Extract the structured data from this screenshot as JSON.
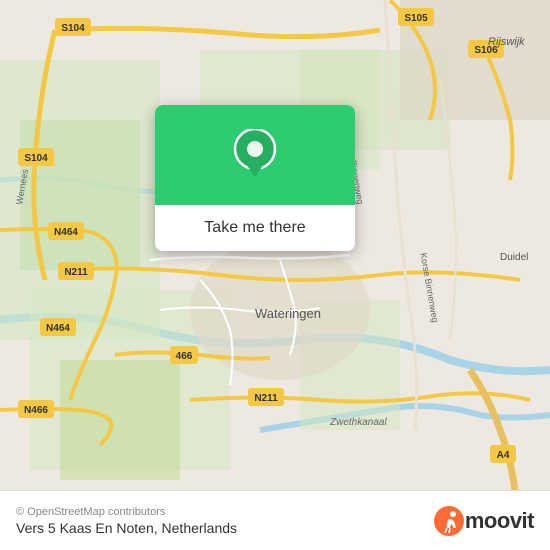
{
  "map": {
    "alt": "OpenStreetMap of Wateringen, Netherlands"
  },
  "popup": {
    "button_label": "Take me there"
  },
  "footer": {
    "copyright": "© OpenStreetMap contributors",
    "location_name": "Vers 5 Kaas En Noten, Netherlands"
  },
  "moovit": {
    "label": "moovit"
  },
  "road_labels": {
    "s104_top": "S104",
    "s104_left": "S104",
    "s105": "S105",
    "s106": "S106",
    "n211_left": "N211",
    "n211_bottom": "N211",
    "n464_top": "N464",
    "n464_bottom": "N464",
    "n466": "N466",
    "r466": "466",
    "a4": "A4",
    "rijswijk": "Rijswijk",
    "wateringen": "Wateringen",
    "duidel": "Duidel",
    "wernees": "Wernees",
    "zwethkanaal": "Zwethkanaal"
  }
}
